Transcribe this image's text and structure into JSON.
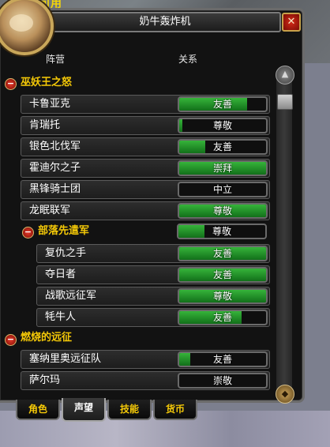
{
  "top_overlay_text": "可用",
  "window": {
    "title": "奶牛轰炸机",
    "close_glyph": "✕"
  },
  "columns": {
    "faction": "阵营",
    "relation": "关系"
  },
  "groups": [
    {
      "name": "巫妖王之怒",
      "toggle": "−"
    },
    {
      "name": "部落先遣军",
      "toggle": "−"
    },
    {
      "name": "燃烧的远征",
      "toggle": "−"
    }
  ],
  "rows": [
    {
      "name": "卡鲁亚克",
      "standing": "友善",
      "progress": 0.78
    },
    {
      "name": "肯瑞托",
      "standing": "尊敬",
      "progress": 0.04
    },
    {
      "name": "银色北伐军",
      "standing": "友善",
      "progress": 0.3
    },
    {
      "name": "霍迪尔之子",
      "standing": "崇拜",
      "progress": 1.0
    },
    {
      "name": "黑锋骑士团",
      "standing": "中立",
      "progress": 0.0
    },
    {
      "name": "龙眠联军",
      "standing": "尊敬",
      "progress": 1.0
    },
    {
      "name": "复仇之手",
      "standing": "友善",
      "progress": 1.0
    },
    {
      "name": "夺日者",
      "standing": "友善",
      "progress": 1.0
    },
    {
      "name": "战歌远征军",
      "standing": "尊敬",
      "progress": 1.0
    },
    {
      "name": "牦牛人",
      "standing": "友善",
      "progress": 0.72
    },
    {
      "name": "塞纳里奥远征队",
      "standing": "友善",
      "progress": 0.13
    },
    {
      "name": "萨尔玛",
      "standing": "崇敬",
      "progress": 0.0
    }
  ],
  "horde_expedition_standing": {
    "standing": "尊敬",
    "progress": 0.3
  },
  "tabs": [
    {
      "label": "角色"
    },
    {
      "label": "声望",
      "active": true
    },
    {
      "label": "技能"
    },
    {
      "label": "货币"
    }
  ],
  "colors": {
    "group_header": "#f5c907",
    "bar_fill": "#36b43a",
    "panel_bg": "#121212",
    "tab_inactive_text": "#f5c907"
  },
  "icons": {
    "scroll_up": "up-arrow-icon",
    "close": "close-icon",
    "collapse": "minus-icon",
    "bottom_right": "tracking-icon"
  }
}
